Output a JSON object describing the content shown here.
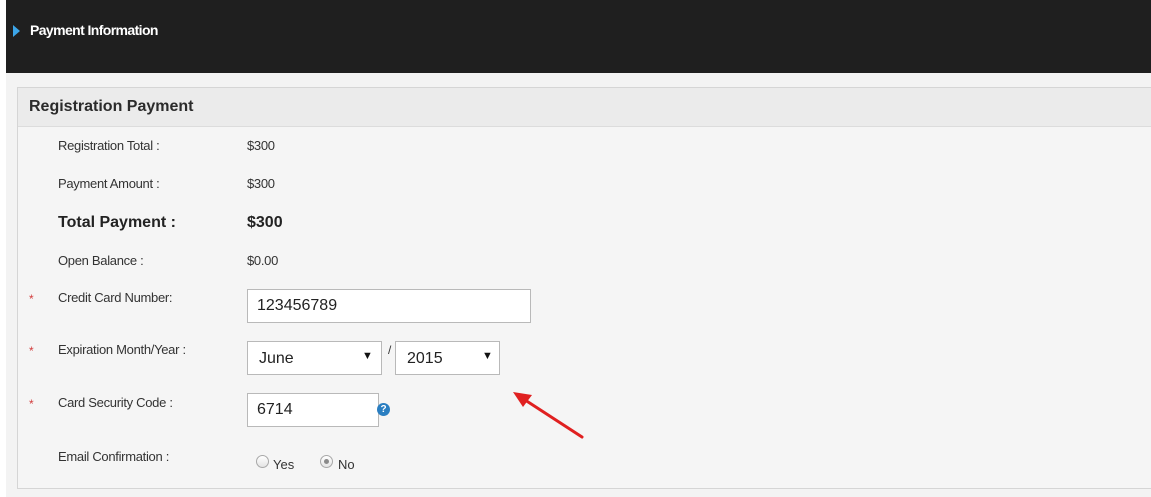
{
  "header": {
    "title": "Payment Information"
  },
  "section": {
    "title": "Registration Payment"
  },
  "summary": {
    "registration_total_label": "Registration Total :",
    "registration_total_value": "$300",
    "payment_amount_label": "Payment Amount :",
    "payment_amount_value": "$300",
    "total_payment_label": "Total Payment :",
    "total_payment_value": "$300",
    "open_balance_label": "Open Balance :",
    "open_balance_value": "$0.00"
  },
  "form": {
    "required_marker": "*",
    "card_number_label": "Credit Card Number:",
    "card_number_value": "123456789",
    "expiration_label": "Expiration Month/Year :",
    "expiration_month": "June",
    "expiration_separator": "/",
    "expiration_year": "2015",
    "dropdown_arrow": "▼",
    "security_code_label": "Card Security Code :",
    "security_code_value": "6714",
    "help_glyph": "?",
    "email_confirmation_label": "Email Confirmation :",
    "email_options": [
      {
        "label": "Yes",
        "checked": false
      },
      {
        "label": "No",
        "checked": true
      }
    ]
  },
  "colors": {
    "header_bg": "#1f1f1f",
    "accent_triangle": "#3ca5e8",
    "required": "#d23c3c",
    "help_icon": "#2a7ec1",
    "annotation_arrow": "#e02020"
  },
  "icons": [
    "expand-triangle-icon",
    "help-icon",
    "dropdown-arrow-icon",
    "annotation-arrow-icon"
  ]
}
